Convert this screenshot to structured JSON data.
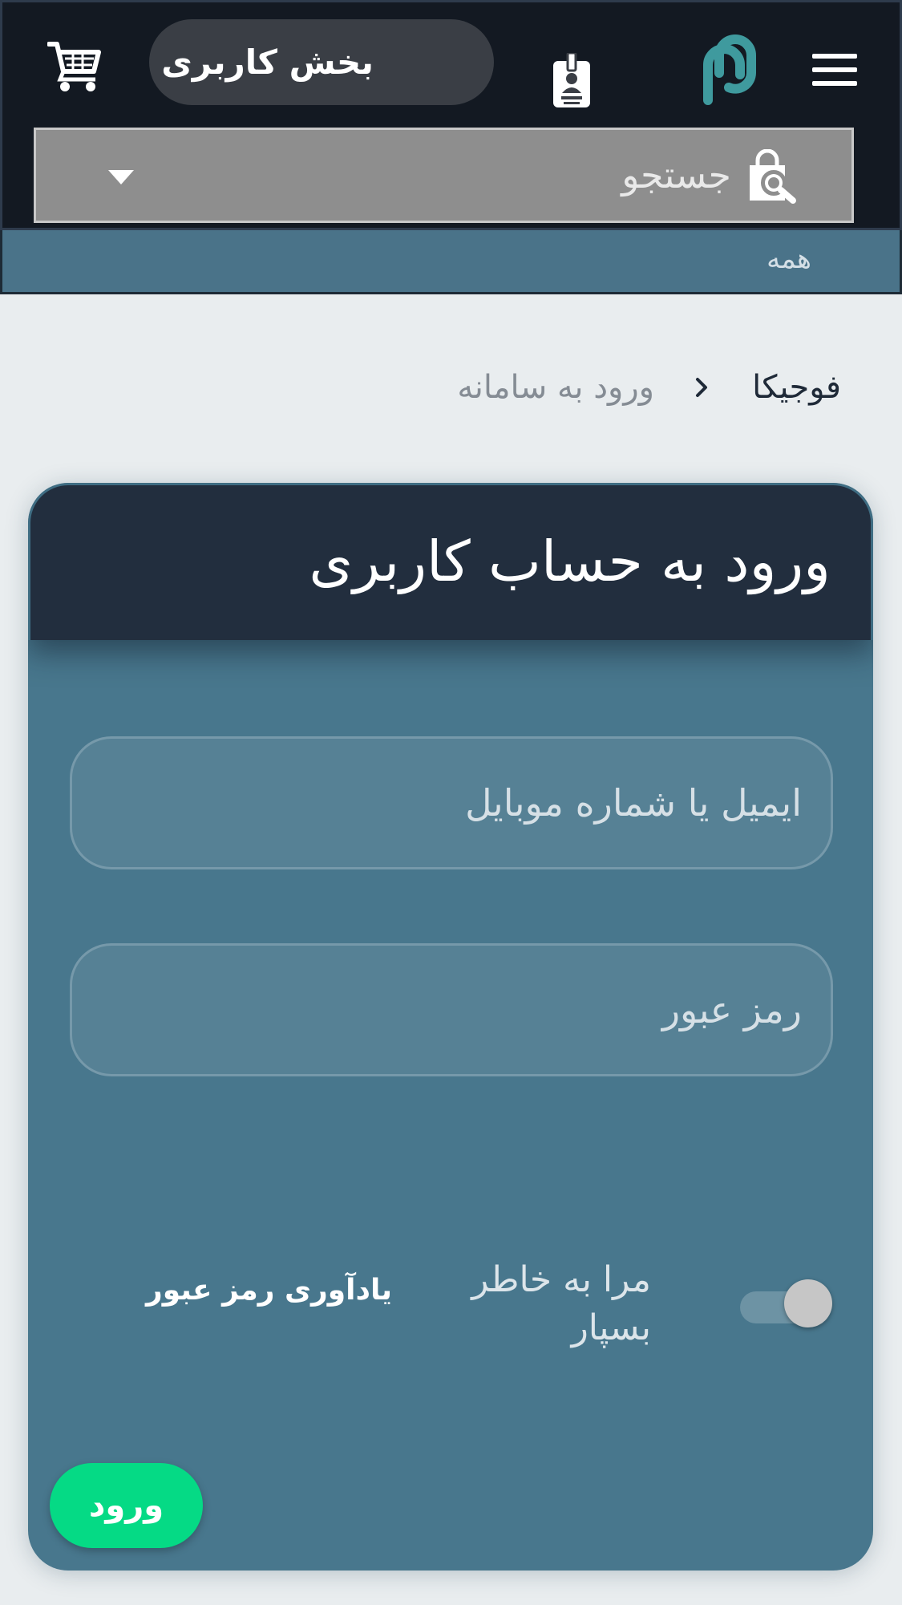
{
  "header": {
    "menu_icon": "hamburger-icon",
    "logo_icon": "chain-link-logo",
    "user_section_label": "بخش کاربری",
    "user_section_icon": "id-badge-icon",
    "cart_icon": "shopping-cart-icon"
  },
  "search": {
    "placeholder": "جستجو",
    "icon": "shopping-bag-search-icon",
    "dropdown_icon": "caret-down-icon"
  },
  "categories": {
    "items": [
      "همه"
    ]
  },
  "breadcrumb": {
    "home": "فوجیکا",
    "separator_icon": "chevron-right-icon",
    "current": "ورود به سامانه"
  },
  "login": {
    "title": "ورود به حساب کاربری",
    "email_placeholder": "ایمیل یا شماره موبایل",
    "email_value": "",
    "password_placeholder": "رمز عبور",
    "password_value": "",
    "remember_label": "مرا به خاطر بسپار",
    "remember_checked": true,
    "forgot_label": "یادآوری رمز عبور",
    "submit_label": "ورود"
  },
  "colors": {
    "topbar_bg": "#131922",
    "category_bar_bg": "#4A7389",
    "card_bg": "#48778D",
    "card_header_bg": "#222E3E",
    "logo_teal": "#3F9A9E",
    "submit_green": "#05DA85"
  }
}
